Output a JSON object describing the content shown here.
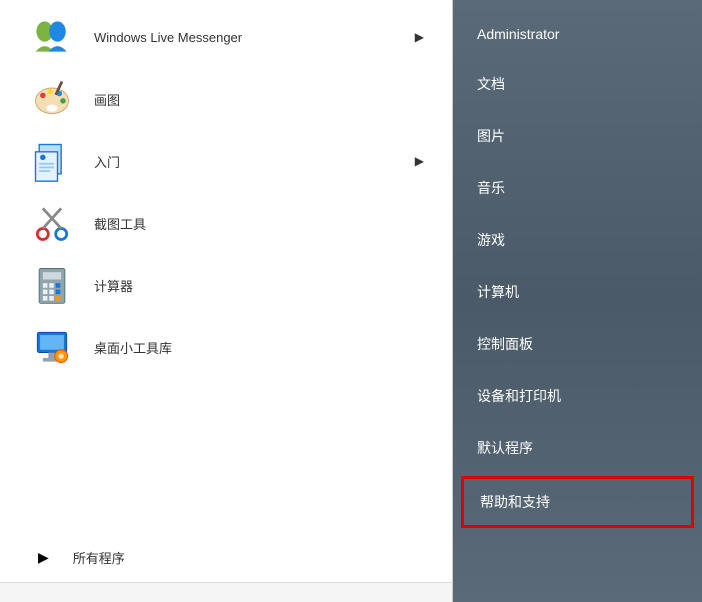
{
  "programs": [
    {
      "label": "Windows Live Messenger",
      "hasSubmenu": true,
      "icon": "messenger"
    },
    {
      "label": "画图",
      "hasSubmenu": false,
      "icon": "paint"
    },
    {
      "label": "入门",
      "hasSubmenu": true,
      "icon": "getting-started"
    },
    {
      "label": "截图工具",
      "hasSubmenu": false,
      "icon": "snipping"
    },
    {
      "label": "计算器",
      "hasSubmenu": false,
      "icon": "calculator"
    },
    {
      "label": "桌面小工具库",
      "hasSubmenu": false,
      "icon": "gadgets"
    }
  ],
  "allPrograms": {
    "label": "所有程序"
  },
  "rightMenu": [
    {
      "label": "Administrator",
      "highlighted": false
    },
    {
      "label": "文档",
      "highlighted": false
    },
    {
      "label": "图片",
      "highlighted": false
    },
    {
      "label": "音乐",
      "highlighted": false
    },
    {
      "label": "游戏",
      "highlighted": false
    },
    {
      "label": "计算机",
      "highlighted": false
    },
    {
      "label": "控制面板",
      "highlighted": false
    },
    {
      "label": "设备和打印机",
      "highlighted": false
    },
    {
      "label": "默认程序",
      "highlighted": false
    },
    {
      "label": "帮助和支持",
      "highlighted": true
    }
  ]
}
